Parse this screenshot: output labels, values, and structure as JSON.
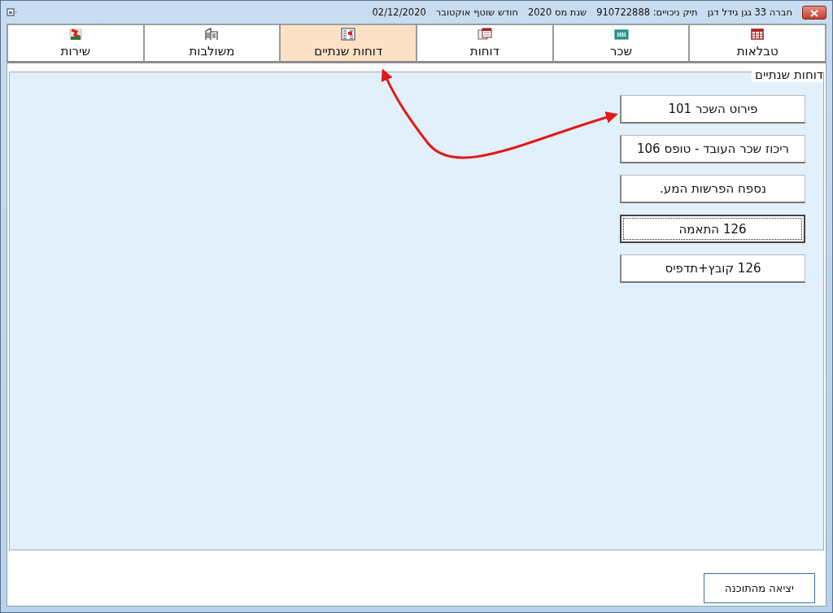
{
  "window": {
    "title_parts": [
      "חברה 33 גגן גידל דגן",
      "תיק ניכויים: 910722888",
      "שנת מס 2020",
      "חודש שוטף אוקטובר",
      "02/12/2020"
    ]
  },
  "tabs": [
    {
      "label": "טבלאות",
      "kind": "table",
      "selected": false
    },
    {
      "label": "שכר",
      "kind": "register",
      "selected": false
    },
    {
      "label": "דוחות",
      "kind": "calendar",
      "selected": false
    },
    {
      "label": "דוחות שנתיים",
      "kind": "report",
      "selected": true
    },
    {
      "label": "משולבות",
      "kind": "building",
      "selected": false
    },
    {
      "label": "שירות",
      "kind": "tool",
      "selected": false
    }
  ],
  "panel": {
    "heading": "דוחות שנתיים",
    "buttons": [
      {
        "label": "פירוט השכר 101",
        "focused": false
      },
      {
        "label": "ריכוז שכר העובד - טופס 106",
        "focused": false
      },
      {
        "label": "נספח הפרשות המע.",
        "focused": false
      },
      {
        "label": "126 התאמה",
        "focused": true
      },
      {
        "label": "126 קובץ+תדפיס",
        "focused": false
      }
    ]
  },
  "footer": {
    "exit_button": "יציאה מהתוכנה"
  }
}
